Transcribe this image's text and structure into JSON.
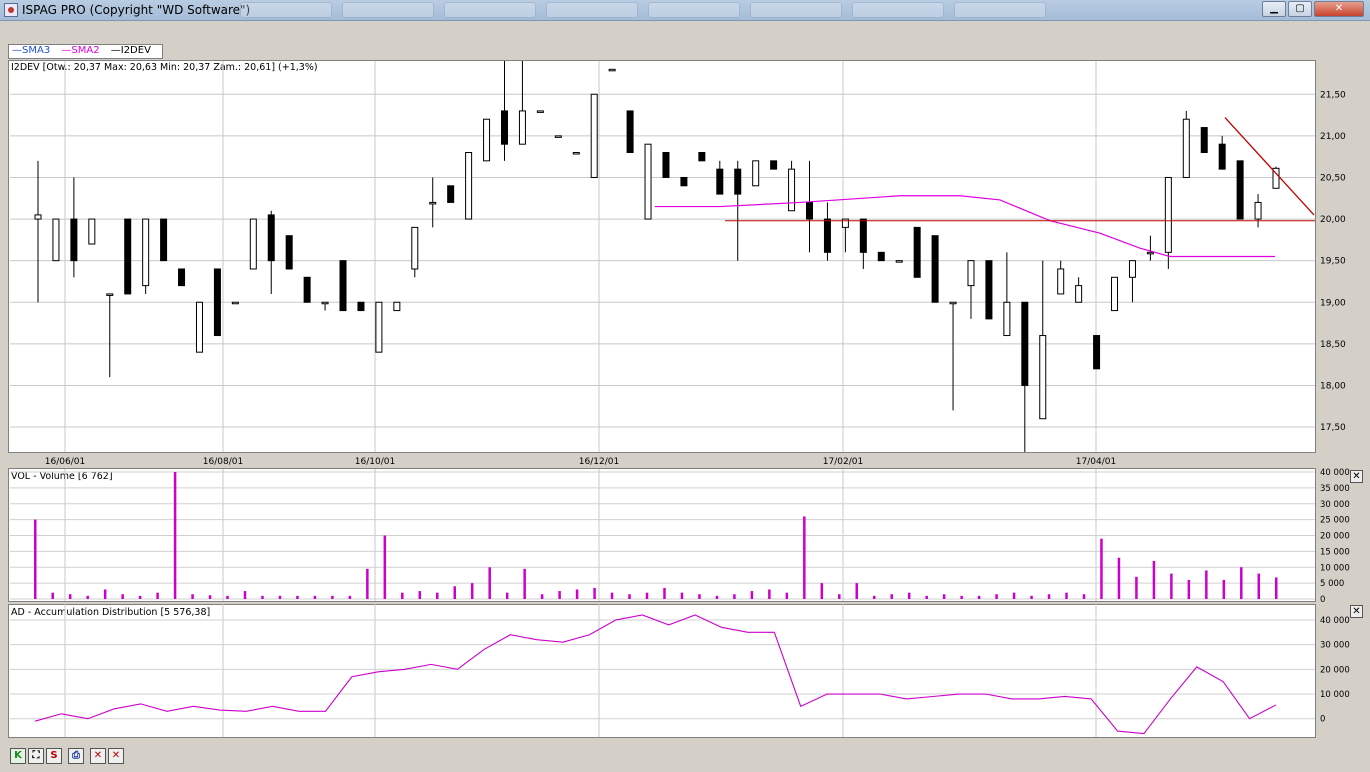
{
  "window": {
    "title": "ISPAG PRO (Copyright \"WD Software\")",
    "minimize": "▁",
    "maximize": "▢",
    "close": "✕"
  },
  "legend": [
    {
      "label": "SMA3",
      "color": "#1f4fd8"
    },
    {
      "label": "SMA2",
      "color": "#e000e0"
    },
    {
      "label": "I2DEV",
      "color": "#000000"
    }
  ],
  "price_panel": {
    "info": "I2DEV [Otw.: 20,37  Max: 20,63  Min: 20,37  Zam.: 20,61] (+1,3%)",
    "y_ticks": [
      "21,50",
      "21,00",
      "20,50",
      "20,00",
      "19,50",
      "19,00",
      "18,50",
      "18,00",
      "17,50"
    ],
    "x_ticks": [
      "16/06/01",
      "16/08/01",
      "16/10/01",
      "16/12/01",
      "17/02/01",
      "17/04/01"
    ]
  },
  "volume_panel": {
    "info": "VOL - Volume [6 762]",
    "y_ticks": [
      "40 000",
      "35 000",
      "30 000",
      "25 000",
      "20 000",
      "15 000",
      "10 000",
      "5 000",
      "0"
    ],
    "close_icon": "✕"
  },
  "ad_panel": {
    "info": "AD - Accumulation Distribution [5 576,38]",
    "y_ticks": [
      "40 000",
      "30 000",
      "20 000",
      "10 000",
      "0"
    ],
    "close_icon": "✕"
  },
  "toolbar": [
    {
      "label": "K",
      "icon": "k-icon",
      "color": "#1a8a1a"
    },
    {
      "label": "⛶",
      "icon": "zoom-fit-icon",
      "color": "#000"
    },
    {
      "label": "S",
      "icon": "s-icon",
      "color": "#c00000"
    },
    {
      "label": "⎙",
      "icon": "print-icon",
      "color": "#1a3a9a"
    },
    {
      "label": "✕",
      "icon": "delete-icon",
      "color": "#c00000"
    },
    {
      "label": "✕",
      "icon": "delete-all-icon",
      "color": "#c00000"
    }
  ],
  "chart_data": {
    "type": "candlestick",
    "x_range": [
      "2016-05",
      "2017-05"
    ],
    "ylim": [
      17.2,
      21.9
    ],
    "grid": true,
    "legend_position": "top-left",
    "sma_level_approx": [
      20.15,
      20.28,
      19.55
    ],
    "horizontal_line": 19.98,
    "trend_line": [
      21.22,
      20.05
    ],
    "candles_approx": [
      {
        "o": 20.0,
        "h": 20.7,
        "l": 19.0,
        "c": 20.05
      },
      {
        "o": 19.5,
        "h": 20.0,
        "l": 19.5,
        "c": 20.0
      },
      {
        "o": 20.0,
        "h": 20.5,
        "l": 19.3,
        "c": 19.5
      },
      {
        "o": 19.7,
        "h": 20.0,
        "l": 19.7,
        "c": 20.0
      },
      {
        "o": 19.1,
        "h": 19.1,
        "l": 18.1,
        "c": 19.1
      },
      {
        "o": 20.0,
        "h": 20.0,
        "l": 19.1,
        "c": 19.1
      },
      {
        "o": 19.2,
        "h": 20.0,
        "l": 19.1,
        "c": 20.0
      },
      {
        "o": 20.0,
        "h": 20.0,
        "l": 19.5,
        "c": 19.5
      },
      {
        "o": 19.4,
        "h": 19.4,
        "l": 19.2,
        "c": 19.2
      },
      {
        "o": 18.4,
        "h": 19.0,
        "l": 18.4,
        "c": 19.0
      },
      {
        "o": 19.4,
        "h": 19.4,
        "l": 18.6,
        "c": 18.6
      },
      {
        "o": 19.0,
        "h": 19.0,
        "l": 19.0,
        "c": 19.0
      },
      {
        "o": 19.4,
        "h": 20.0,
        "l": 19.4,
        "c": 20.0
      },
      {
        "o": 20.05,
        "h": 20.1,
        "l": 19.1,
        "c": 19.5
      },
      {
        "o": 19.8,
        "h": 19.8,
        "l": 19.4,
        "c": 19.4
      },
      {
        "o": 19.3,
        "h": 19.3,
        "l": 19.0,
        "c": 19.0
      },
      {
        "o": 19.0,
        "h": 19.0,
        "l": 18.9,
        "c": 19.0
      },
      {
        "o": 19.5,
        "h": 19.5,
        "l": 18.9,
        "c": 18.9
      },
      {
        "o": 19.0,
        "h": 19.0,
        "l": 18.9,
        "c": 18.9
      },
      {
        "o": 18.4,
        "h": 19.0,
        "l": 18.4,
        "c": 19.0
      },
      {
        "o": 18.9,
        "h": 19.0,
        "l": 18.9,
        "c": 19.0
      },
      {
        "o": 19.4,
        "h": 19.9,
        "l": 19.3,
        "c": 19.9
      },
      {
        "o": 20.2,
        "h": 20.5,
        "l": 19.9,
        "c": 20.2
      },
      {
        "o": 20.4,
        "h": 20.4,
        "l": 20.2,
        "c": 20.2
      },
      {
        "o": 20.0,
        "h": 20.8,
        "l": 20.0,
        "c": 20.8
      },
      {
        "o": 20.7,
        "h": 21.2,
        "l": 20.7,
        "c": 21.2
      },
      {
        "o": 21.3,
        "h": 21.9,
        "l": 20.7,
        "c": 20.9
      },
      {
        "o": 20.9,
        "h": 21.9,
        "l": 20.9,
        "c": 21.3
      },
      {
        "o": 21.3,
        "h": 21.3,
        "l": 21.3,
        "c": 21.3
      },
      {
        "o": 21.0,
        "h": 21.0,
        "l": 21.0,
        "c": 21.0
      },
      {
        "o": 20.8,
        "h": 20.8,
        "l": 20.8,
        "c": 20.8
      },
      {
        "o": 20.5,
        "h": 21.5,
        "l": 20.5,
        "c": 21.5
      },
      {
        "o": 21.8,
        "h": 21.8,
        "l": 21.8,
        "c": 21.8
      },
      {
        "o": 21.3,
        "h": 21.3,
        "l": 20.8,
        "c": 20.8
      },
      {
        "o": 20.0,
        "h": 20.9,
        "l": 20.0,
        "c": 20.9
      },
      {
        "o": 20.8,
        "h": 20.8,
        "l": 20.5,
        "c": 20.5
      },
      {
        "o": 20.5,
        "h": 20.5,
        "l": 20.4,
        "c": 20.4
      },
      {
        "o": 20.8,
        "h": 20.8,
        "l": 20.7,
        "c": 20.7
      },
      {
        "o": 20.6,
        "h": 20.7,
        "l": 20.3,
        "c": 20.3
      },
      {
        "o": 20.6,
        "h": 20.7,
        "l": 19.5,
        "c": 20.3
      },
      {
        "o": 20.4,
        "h": 20.7,
        "l": 20.4,
        "c": 20.7
      },
      {
        "o": 20.7,
        "h": 20.7,
        "l": 20.6,
        "c": 20.6
      },
      {
        "o": 20.1,
        "h": 20.7,
        "l": 20.1,
        "c": 20.6
      },
      {
        "o": 20.2,
        "h": 20.7,
        "l": 19.6,
        "c": 20.0
      },
      {
        "o": 20.0,
        "h": 20.2,
        "l": 19.5,
        "c": 19.6
      },
      {
        "o": 19.9,
        "h": 20.0,
        "l": 19.6,
        "c": 20.0
      },
      {
        "o": 20.0,
        "h": 20.0,
        "l": 19.4,
        "c": 19.6
      },
      {
        "o": 19.6,
        "h": 19.6,
        "l": 19.5,
        "c": 19.5
      },
      {
        "o": 19.5,
        "h": 19.5,
        "l": 19.5,
        "c": 19.5
      },
      {
        "o": 19.9,
        "h": 19.9,
        "l": 19.3,
        "c": 19.3
      },
      {
        "o": 19.8,
        "h": 19.8,
        "l": 19.0,
        "c": 19.0
      },
      {
        "o": 19.0,
        "h": 19.0,
        "l": 17.7,
        "c": 19.0
      },
      {
        "o": 19.2,
        "h": 19.5,
        "l": 18.8,
        "c": 19.5
      },
      {
        "o": 19.5,
        "h": 19.5,
        "l": 18.8,
        "c": 18.8
      },
      {
        "o": 18.6,
        "h": 19.6,
        "l": 18.6,
        "c": 19.0
      },
      {
        "o": 19.0,
        "h": 19.0,
        "l": 17.2,
        "c": 18.0
      },
      {
        "o": 17.6,
        "h": 19.5,
        "l": 17.6,
        "c": 18.6
      },
      {
        "o": 19.1,
        "h": 19.5,
        "l": 19.1,
        "c": 19.4
      },
      {
        "o": 19.0,
        "h": 19.3,
        "l": 19.0,
        "c": 19.2
      },
      {
        "o": 18.6,
        "h": 18.6,
        "l": 18.2,
        "c": 18.2
      },
      {
        "o": 18.9,
        "h": 19.3,
        "l": 18.9,
        "c": 19.3
      },
      {
        "o": 19.3,
        "h": 19.5,
        "l": 19.0,
        "c": 19.5
      },
      {
        "o": 19.6,
        "h": 19.8,
        "l": 19.5,
        "c": 19.6
      },
      {
        "o": 19.6,
        "h": 20.5,
        "l": 19.4,
        "c": 20.5
      },
      {
        "o": 20.5,
        "h": 21.3,
        "l": 20.5,
        "c": 21.2
      },
      {
        "o": 21.1,
        "h": 21.1,
        "l": 20.8,
        "c": 20.8
      },
      {
        "o": 20.9,
        "h": 21.0,
        "l": 20.6,
        "c": 20.6
      },
      {
        "o": 20.7,
        "h": 20.7,
        "l": 20.0,
        "c": 20.0
      },
      {
        "o": 20.0,
        "h": 20.3,
        "l": 19.9,
        "c": 20.2
      },
      {
        "o": 20.37,
        "h": 20.63,
        "l": 20.37,
        "c": 20.61
      }
    ],
    "volume_approx": [
      25000,
      2000,
      1500,
      1000,
      3000,
      1500,
      1000,
      2000,
      40000,
      1500,
      1200,
      1000,
      2500,
      1000,
      1000,
      1000,
      1000,
      1000,
      1000,
      9500,
      20000,
      2000,
      2500,
      2000,
      4000,
      5000,
      10000,
      2000,
      9500,
      1500,
      2500,
      3000,
      3500,
      2000,
      1500,
      2000,
      3500,
      2000,
      1500,
      1000,
      1500,
      2500,
      3000,
      2000,
      26000,
      5000,
      1500,
      5000,
      1000,
      1500,
      2000,
      1000,
      1500,
      1000,
      1000,
      1500,
      2000,
      1000,
      1500,
      2000,
      1500,
      19000,
      13000,
      7000,
      12000,
      8000,
      6000,
      9000,
      6000,
      10000,
      8000,
      6800
    ],
    "ad_approx": [
      -1000,
      2000,
      0,
      4000,
      6000,
      3000,
      5000,
      3500,
      3000,
      5000,
      3000,
      3000,
      17000,
      19000,
      20000,
      22000,
      20000,
      28000,
      34000,
      32000,
      31000,
      34000,
      40000,
      42000,
      38000,
      42000,
      37000,
      35000,
      35000,
      5000,
      10000,
      10000,
      10000,
      8000,
      9000,
      10000,
      10000,
      8000,
      8000,
      9000,
      8000,
      -5000,
      -6000,
      8000,
      21000,
      15000,
      0,
      5576
    ]
  }
}
